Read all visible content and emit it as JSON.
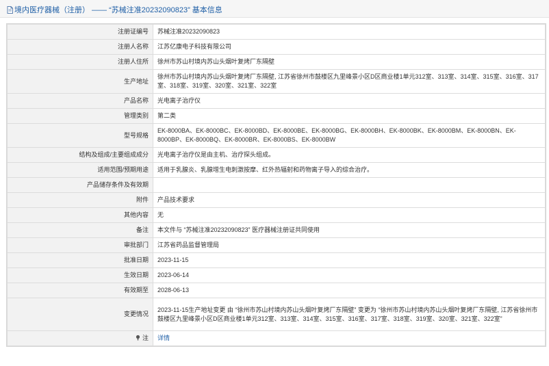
{
  "header": {
    "title": "境内医疗器械（注册） —— “苏械注准20232090823” 基本信息",
    "icon": "document-icon"
  },
  "rows": [
    {
      "label": "注册证编号",
      "value": "苏械注准20232090823"
    },
    {
      "label": "注册人名称",
      "value": "江苏亿康电子科技有限公司"
    },
    {
      "label": "注册人住所",
      "value": "徐州市苏山村境内苏山头烟叶复烤厂东隔壁"
    },
    {
      "label": "生产地址",
      "value": "徐州市苏山村境内苏山头烟叶复烤厂东隔壁, 江苏省徐州市鼓楼区九里峰景小区D区商业楼1单元312室、313室、314室、315室、316室、317室、318室、319室、320室、321室、322室"
    },
    {
      "label": "产品名称",
      "value": "光电离子治疗仪"
    },
    {
      "label": "管理类别",
      "value": "第二类"
    },
    {
      "label": "型号规格",
      "value": "EK-8000BA、EK-8000BC、EK-8000BD、EK-8000BE、EK-8000BG、EK-8000BH、EK-8000BK、EK-8000BM、EK-8000BN、EK-8000BP、EK-8000BQ、EK-8000BR、EK-8000BS、EK-8000BW"
    },
    {
      "label": "结构及组成/主要组成成分",
      "value": "光电离子治疗仪是由主机、治疗探头组成。"
    },
    {
      "label": "适用范围/预期用途",
      "value": "适用于乳腺炎、乳腺增生电刺激按摩、红外热辐射和药物离子导入的综合治疗。"
    },
    {
      "label": "产品储存条件及有效期",
      "value": ""
    },
    {
      "label": "附件",
      "value": "产品技术要求"
    },
    {
      "label": "其他内容",
      "value": "无"
    },
    {
      "label": "备注",
      "value": "本文件与 “苏械注准20232090823” 医疗器械注册证共同使用"
    },
    {
      "label": "审批部门",
      "value": "江苏省药品监督管理局"
    },
    {
      "label": "批准日期",
      "value": "2023-11-15"
    },
    {
      "label": "生效日期",
      "value": "2023-06-14"
    },
    {
      "label": "有效期至",
      "value": "2028-06-13"
    },
    {
      "label": "变更情况",
      "value": "2023-11-15生产地址变更 由 “徐州市苏山村境内苏山头烟叶复烤厂东隔壁” 变更为 “徐州市苏山村境内苏山头烟叶复烤厂东隔壁, 江苏省徐州市鼓楼区九里峰景小区D区商业楼1单元312室、313室、314室、315室、316室、317室、318室、319室、320室、321室、322室”"
    }
  ],
  "note_row": {
    "label": "注",
    "icon": "note-icon",
    "link_text": "详情"
  }
}
